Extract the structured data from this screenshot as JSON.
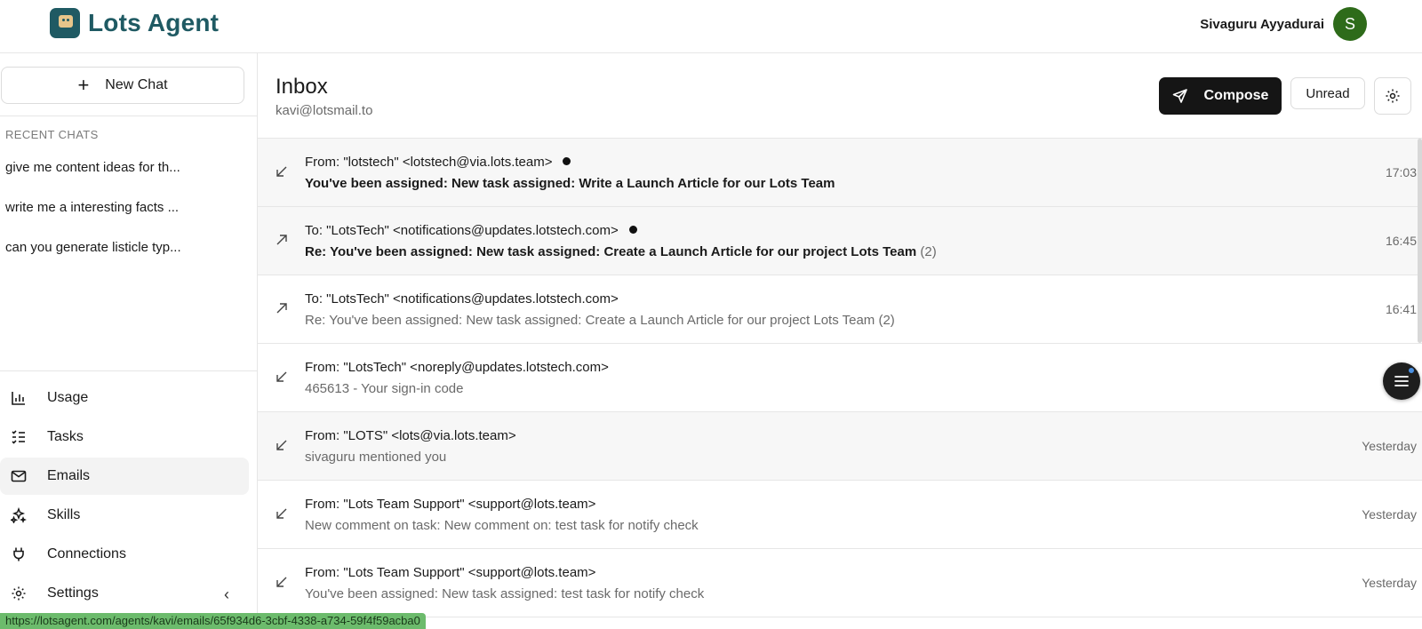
{
  "header": {
    "app_name": "Lots Agent",
    "user_name": "Sivaguru Ayyadurai",
    "avatar_initial": "S",
    "avatar_color": "#2e6b1a"
  },
  "sidebar": {
    "new_chat_label": "New Chat",
    "recent_title": "RECENT CHATS",
    "recent_chats": [
      "give me content ideas for th...",
      "write me a interesting facts ...",
      "can you generate listicle typ..."
    ],
    "nav": [
      {
        "label": "Usage",
        "icon": "bar-chart-icon",
        "active": false
      },
      {
        "label": "Tasks",
        "icon": "checklist-icon",
        "active": false
      },
      {
        "label": "Emails",
        "icon": "mail-icon",
        "active": true
      },
      {
        "label": "Skills",
        "icon": "sparkles-icon",
        "active": false
      },
      {
        "label": "Connections",
        "icon": "plug-icon",
        "active": false
      },
      {
        "label": "Settings",
        "icon": "gear-icon",
        "active": false
      }
    ]
  },
  "main": {
    "title": "Inbox",
    "address": "kavi@lotsmail.to",
    "compose_label": "Compose",
    "unread_label": "Unread",
    "emails": [
      {
        "direction": "in",
        "from": "From: \"lotstech\" <lotstech@via.lots.team>",
        "subject": "You've been assigned: New task assigned: Write a Launch Article for our Lots Team",
        "count": "",
        "time": "17:03",
        "unread": true
      },
      {
        "direction": "out",
        "from": "To: \"LotsTech\" <notifications@updates.lotstech.com>",
        "subject": "Re: You've been assigned: New task assigned: Create a Launch Article for our project Lots Team",
        "count": "(2)",
        "time": "16:45",
        "unread": true
      },
      {
        "direction": "out",
        "from": "To: \"LotsTech\" <notifications@updates.lotstech.com>",
        "subject": "Re: You've been assigned: New task assigned: Create a Launch Article for our project Lots Team (2)",
        "count": "",
        "time": "16:41",
        "unread": false
      },
      {
        "direction": "in",
        "from": "From: \"LotsTech\" <noreply@updates.lotstech.com>",
        "subject": "465613 - Your sign-in code",
        "count": "",
        "time": "",
        "unread": false
      },
      {
        "direction": "in",
        "from": "From: \"LOTS\" <lots@via.lots.team>",
        "subject": "sivaguru mentioned you",
        "count": "",
        "time": "Yesterday",
        "unread": false
      },
      {
        "direction": "in",
        "from": "From: \"Lots Team Support\" <support@lots.team>",
        "subject": "New comment on task: New comment on: test task for notify check",
        "count": "",
        "time": "Yesterday",
        "unread": false
      },
      {
        "direction": "in",
        "from": "From: \"Lots Team Support\" <support@lots.team>",
        "subject": "You've been assigned: New task assigned: test task for notify check",
        "count": "",
        "time": "Yesterday",
        "unread": false
      }
    ]
  },
  "status_url": "https://lotsagent.com/agents/kavi/emails/65f934d6-3cbf-4338-a734-59f4f59acba0",
  "colors": {
    "brand": "#1f5a63",
    "compose_bg": "#151515",
    "status_bar": "#6cbb6c"
  }
}
